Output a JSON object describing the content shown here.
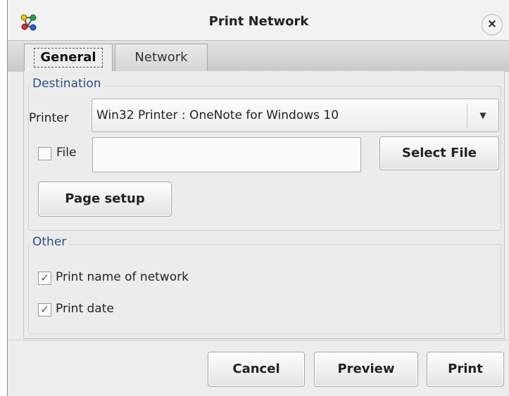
{
  "window": {
    "title": "Print Network",
    "app_icon": "network-nodes-icon",
    "close_label": "×"
  },
  "tabs": [
    {
      "label": "General",
      "active": true
    },
    {
      "label": "Network",
      "active": false
    }
  ],
  "destination": {
    "title": "Destination",
    "printer_label": "Printer",
    "printer_value": "Win32 Printer : OneNote for Windows 10",
    "file_label": "File",
    "file_checked": false,
    "file_value": "",
    "select_file_label": "Select File",
    "page_setup_label": "Page setup"
  },
  "other": {
    "title": "Other",
    "print_name_label": "Print name of network",
    "print_name_checked": true,
    "print_date_label": "Print date",
    "print_date_checked": true
  },
  "footer": {
    "cancel_label": "Cancel",
    "preview_label": "Preview",
    "print_label": "Print"
  },
  "colors": {
    "group_title": "#2b4f86",
    "window_bg": "#ededed"
  }
}
